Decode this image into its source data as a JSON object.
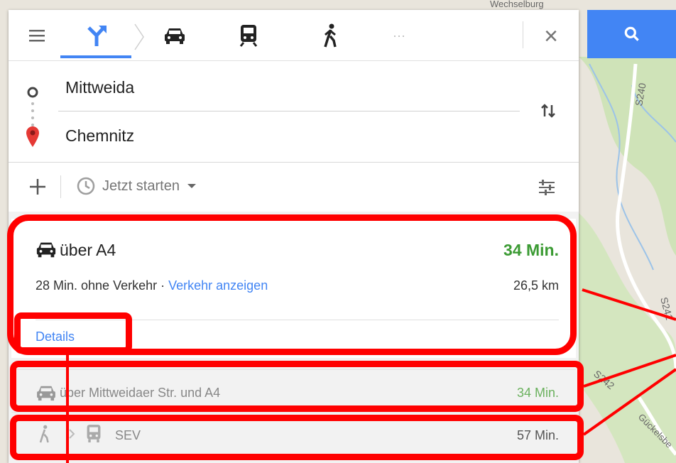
{
  "map": {
    "labels": [
      "S240",
      "S241",
      "S242",
      "Gückelsbe",
      "Wechselburg"
    ]
  },
  "modes": [
    {
      "name": "best-route",
      "icon": "route-fork-icon"
    },
    {
      "name": "car",
      "icon": "car-icon"
    },
    {
      "name": "transit",
      "icon": "train-icon"
    },
    {
      "name": "walk",
      "icon": "walk-icon"
    },
    {
      "name": "more",
      "label": "···"
    }
  ],
  "header": {
    "close_label": "×"
  },
  "waypoints": {
    "origin": "Mittweida",
    "destination": "Chemnitz"
  },
  "options": {
    "depart_label": "Jetzt starten"
  },
  "routes": [
    {
      "title": "über A4",
      "time": "34 Min.",
      "subtitle_plain": "28 Min. ohne Verkehr · ",
      "subtitle_link": "Verkehr anzeigen",
      "distance": "26,5 km",
      "details_label": "Details"
    },
    {
      "title": "über Mittweidaer Str. und A4",
      "time": "34 Min."
    },
    {
      "title": "SEV",
      "time": "57 Min."
    }
  ],
  "colors": {
    "accent": "#4285f4",
    "time_green": "#3c9b34",
    "annotation_red": "#ff0000"
  }
}
